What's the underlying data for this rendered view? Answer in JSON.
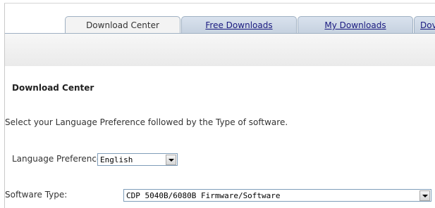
{
  "tabs": [
    {
      "label": "Download Center",
      "active": true
    },
    {
      "label": "Free Downloads",
      "active": false
    },
    {
      "label": "My Downloads",
      "active": false
    },
    {
      "label": "Dov",
      "active": false
    }
  ],
  "section": {
    "title": "Download Center",
    "instruction": "Select your Language Preference followed by the Type of software."
  },
  "language": {
    "label": "Language Preference:",
    "selected": "English",
    "icon": "chevron-down-icon"
  },
  "software": {
    "label": "Software Type:",
    "selected": "CDP 5040B/6080B Firmware/Software",
    "icon": "chevron-down-icon"
  },
  "colors": {
    "tab_border": "#9fb0c2",
    "tab_inactive": "#c4d0de",
    "link": "#1a1a80",
    "select_border": "#7f9db9"
  }
}
